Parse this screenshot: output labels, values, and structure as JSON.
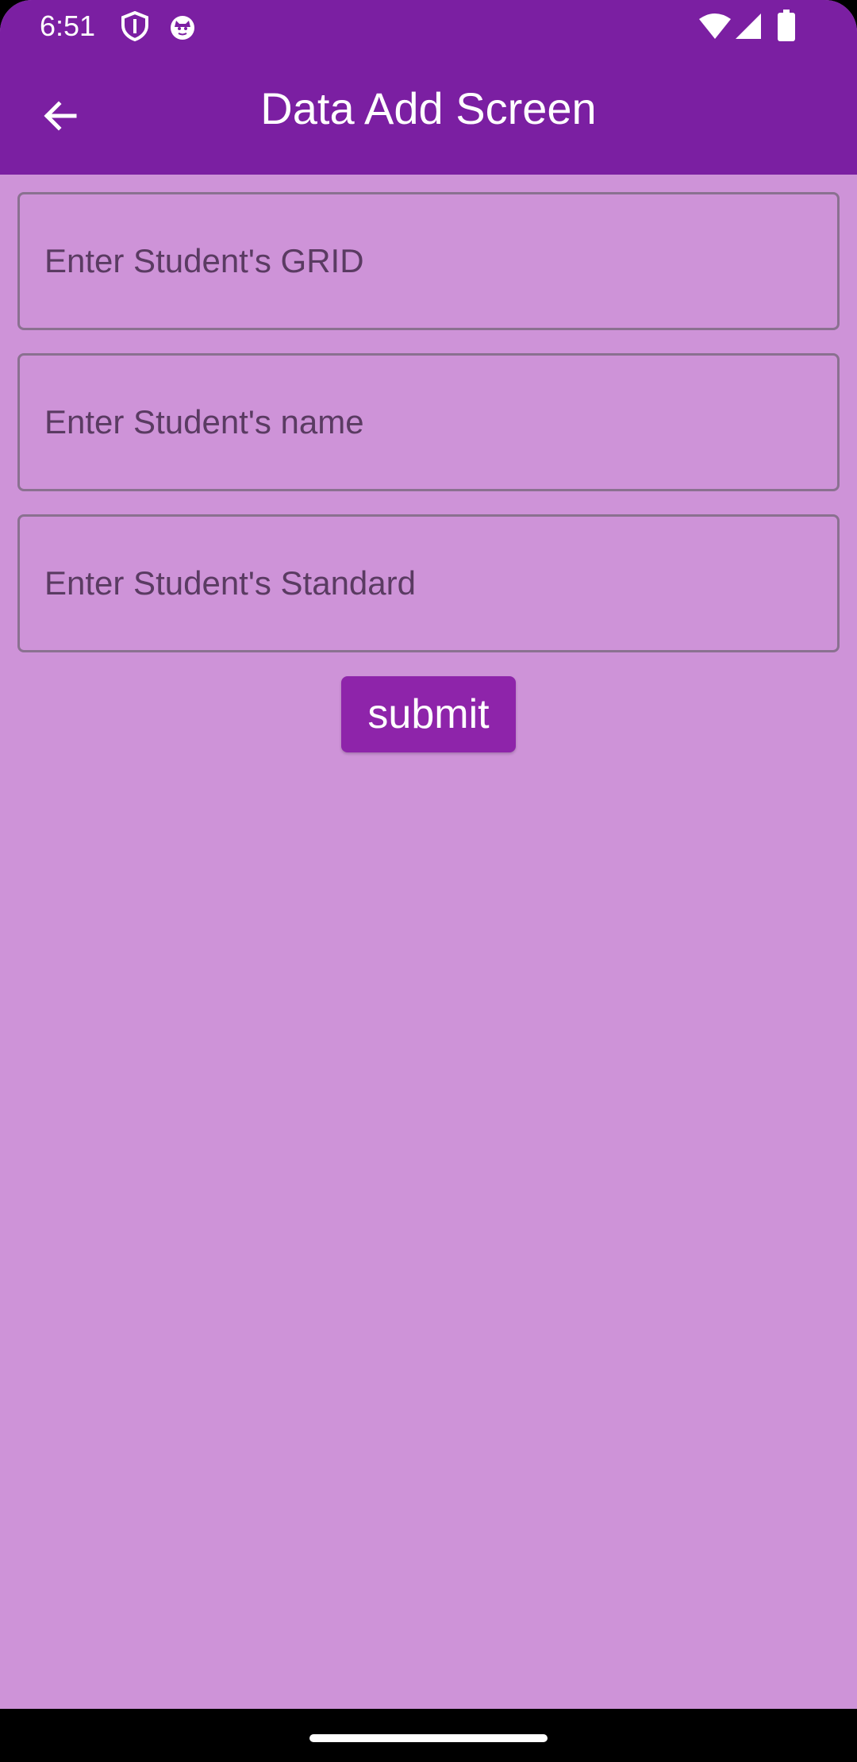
{
  "status_bar": {
    "time": "6:51",
    "icons_left": [
      "shield-icon",
      "cat-icon"
    ],
    "icons_right": [
      "wifi-icon",
      "signal-icon",
      "battery-icon"
    ]
  },
  "app_bar": {
    "title": "Data Add Screen",
    "back_icon": "arrow-left-icon"
  },
  "form": {
    "grid_field": {
      "placeholder": "Enter Student's GRID",
      "value": ""
    },
    "name_field": {
      "placeholder": "Enter Student's name",
      "value": ""
    },
    "standard_field": {
      "placeholder": "Enter Student's Standard",
      "value": ""
    },
    "submit_label": "submit"
  },
  "colors": {
    "app_bar": "#7b1fa2",
    "background": "#ce93d8",
    "button": "#8e24aa"
  }
}
